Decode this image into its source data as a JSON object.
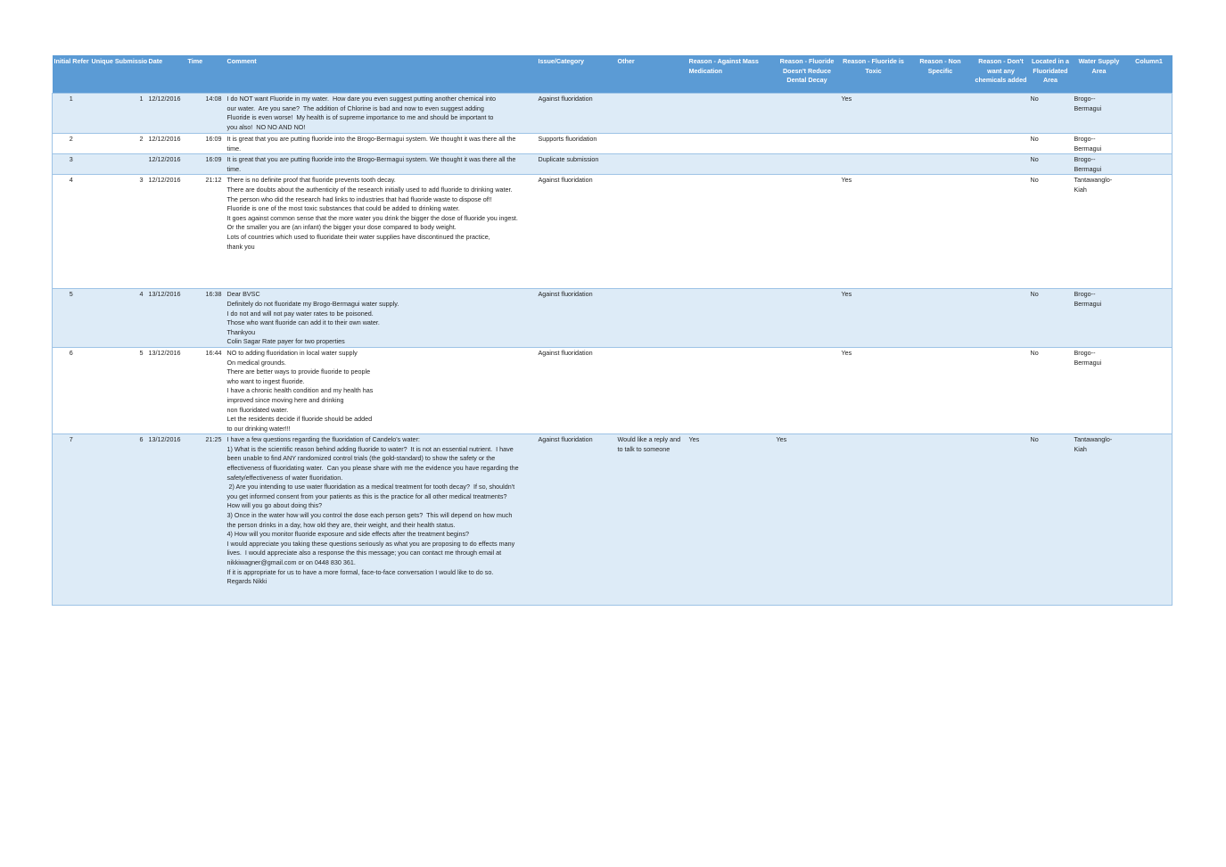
{
  "headers": [
    "Initial Refer",
    "Unique Submission",
    "Date",
    "Time",
    "Comment",
    "Issue/Category",
    "Other",
    "Reason - Against Mass Medication",
    "Reason - Fluoride Doesn't Reduce Dental Decay",
    "Reason - Fluoride is Toxic",
    "Reason - Non Specific",
    "Reason - Don't want any chemicals added",
    "Located in a Fluoridated Area",
    "Water Supply Area",
    "Column1"
  ],
  "rows": [
    {
      "initial": "1",
      "unique": "1",
      "date": "12/12/2016",
      "time": "14:08",
      "comment": "I do NOT want Fluoride in my water.  How dare you even suggest putting another chemical into\nour water.  Are you sane?  The addition of Chlorine is bad and now to even suggest adding\nFluoride is even worse!  My health is of supreme importance to me and should be important to\nyou also!  NO NO AND NO!",
      "category": "Against fluoridation",
      "other": "",
      "mass_medication": "",
      "no_decay": "",
      "toxic": "Yes",
      "non_specific": "",
      "no_chemicals": "",
      "fluoridated_area": "No",
      "water_supply": "Brogo--\nBermagui",
      "column1": ""
    },
    {
      "initial": "2",
      "unique": "2",
      "date": "12/12/2016",
      "time": "16:09",
      "comment": "It is great that you are putting fluoride into the Brogo-Bermagui system. We thought it was there all the\ntime.",
      "category": "Supports fluoridation",
      "other": "",
      "mass_medication": "",
      "no_decay": "",
      "toxic": "",
      "non_specific": "",
      "no_chemicals": "",
      "fluoridated_area": "No",
      "water_supply": "Brogo--\nBermagui",
      "column1": ""
    },
    {
      "initial": "3",
      "unique": "",
      "date": "12/12/2016",
      "time": "16:09",
      "comment": "It is great that you are putting fluoride into the Brogo-Bermagui system. We thought it was there all the\ntime.",
      "category": "Duplicate submission",
      "other": "",
      "mass_medication": "",
      "no_decay": "",
      "toxic": "",
      "non_specific": "",
      "no_chemicals": "",
      "fluoridated_area": "No",
      "water_supply": "Brogo--\nBermagui",
      "column1": ""
    },
    {
      "initial": "4",
      "unique": "3",
      "date": "12/12/2016",
      "time": "21:12",
      "comment": "There is no definite proof that fluoride prevents tooth decay.\nThere are doubts about the authenticity of the research initially used to add fluoride to drinking water.\nThe person who did the research had links to industries that had fluoride waste to dispose of!!\nFluoride is one of the most toxic substances that could be added to drinking water.\nIt goes against common sense that the more water you drink the bigger the dose of fluoride you ingest.\nOr the smaller you are (an infant) the bigger your dose compared to body weight.\nLots of countries which used to fluoridate their water supplies have discontinued the practice,\nthank you",
      "category": "Against fluoridation",
      "other": "",
      "mass_medication": "",
      "no_decay": "",
      "toxic": "Yes",
      "non_specific": "",
      "no_chemicals": "",
      "fluoridated_area": "No",
      "water_supply": "Tantawanglo-\nKiah",
      "column1": ""
    },
    {
      "initial": "5",
      "unique": "4",
      "date": "13/12/2016",
      "time": "16:38",
      "comment": "Dear BVSC\nDefinitely do not fluoridate my Brogo-Bermagui water supply.\nI do not and will not pay water rates to be poisoned.\nThose who want fluoride can add it to their own water.\nThankyou\nColin Sagar Rate payer for two properties",
      "category": "Against fluoridation",
      "other": "",
      "mass_medication": "",
      "no_decay": "",
      "toxic": "Yes",
      "non_specific": "",
      "no_chemicals": "",
      "fluoridated_area": "No",
      "water_supply": "Brogo--\nBermagui",
      "column1": ""
    },
    {
      "initial": "6",
      "unique": "5",
      "date": "13/12/2016",
      "time": "16:44",
      "comment": "NO to adding fluoridation in local water supply\nOn medical grounds.\nThere are better ways to provide fluoride to people\nwho want to ingest fluoride.\nI have a chronic health condition and my health has\nimproved since moving here and drinking\nnon fluoridated water.\nLet the residents decide if fluoride should be added\nto our drinking water!!!",
      "category": "Against fluoridation",
      "other": "",
      "mass_medication": "",
      "no_decay": "",
      "toxic": "Yes",
      "non_specific": "",
      "no_chemicals": "",
      "fluoridated_area": "No",
      "water_supply": "Brogo--\nBermagui",
      "column1": ""
    },
    {
      "initial": "7",
      "unique": "6",
      "date": "13/12/2016",
      "time": "21:25",
      "comment": "I have a few questions regarding the fluoridation of Candelo's water:\n1) What is the scientific reason behind adding fluoride to water?  It is not an essential nutrient.  I have\nbeen unable to find ANY randomized control trials (the gold-standard) to show the safety or the\neffectiveness of fluoridating water.  Can you please share with me the evidence you have regarding the\nsafety/effectiveness of water fluoridation.\n 2) Are you intending to use water fluoridation as a medical treatment for tooth decay?  If so, shouldn't\nyou get informed consent from your patients as this is the practice for all other medical treatments?\nHow will you go about doing this?\n3) Once in the water how will you control the dose each person gets?  This will depend on how much\nthe person drinks in a day, how old they are, their weight, and their health status.\n4) How will you monitor fluoride exposure and side effects after the treatment begins?\nI would appreciate you taking these questions seriously as what you are proposing to do effects many\nlives.  I would appreciate also a response the this message; you can contact me through email at\nnikkiwagner@gmail.com or on 0448 830 361.\nIf it is appropriate for us to have a more formal, face-to-face conversation I would like to do so.\nRegards Nikki",
      "category": "Against fluoridation",
      "other": "Would like a reply and\nto talk to someone",
      "mass_medication": "Yes",
      "no_decay": "Yes",
      "toxic": "",
      "non_specific": "",
      "no_chemicals": "",
      "fluoridated_area": "No",
      "water_supply": "Tantawanglo-\nKiah",
      "column1": ""
    }
  ]
}
